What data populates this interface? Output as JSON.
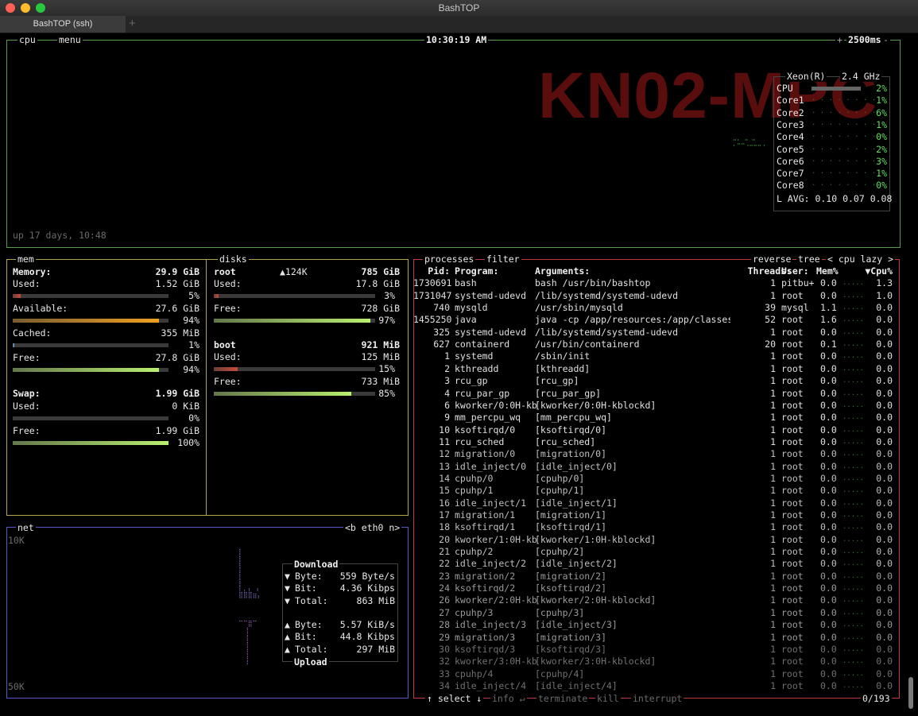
{
  "window": {
    "title": "BashTOP",
    "tab": "BashTOP (ssh)",
    "new_tab": "+"
  },
  "cpu": {
    "label": "cpu",
    "menu_label": "menu",
    "clock": "10:30:19 AM",
    "interval": "2500ms",
    "interval_plus": "+",
    "interval_minus": "-",
    "uptime": "up 17 days, 10:48",
    "hostname": "KN02-MPC",
    "model": "Xeon(R)",
    "freq": "2.4 GHz",
    "cores": [
      {
        "name": "CPU",
        "pct": "2%"
      },
      {
        "name": "Core1",
        "pct": "1%"
      },
      {
        "name": "Core2",
        "pct": "6%"
      },
      {
        "name": "Core3",
        "pct": "1%"
      },
      {
        "name": "Core4",
        "pct": "0%"
      },
      {
        "name": "Core5",
        "pct": "2%"
      },
      {
        "name": "Core6",
        "pct": "3%"
      },
      {
        "name": "Core7",
        "pct": "1%"
      },
      {
        "name": "Core8",
        "pct": "0%"
      }
    ],
    "load_avg": "L AVG: 0.10 0.07 0.08"
  },
  "mem": {
    "label": "mem",
    "memory": {
      "label": "Memory:",
      "value": "29.9 GiB"
    },
    "used": {
      "label": "Used:",
      "value": "1.52 GiB",
      "pct": "5%",
      "level": 0.05,
      "color": "#c84a3a"
    },
    "available": {
      "label": "Available:",
      "value": "27.6 GiB",
      "pct": "94%",
      "level": 0.94,
      "color": "#f0a020"
    },
    "cached": {
      "label": "Cached:",
      "value": "355 MiB",
      "pct": "1%",
      "level": 0.01,
      "color": "#7ab0e0"
    },
    "free": {
      "label": "Free:",
      "value": "27.8 GiB",
      "pct": "94%",
      "level": 0.94,
      "color": "#b8f070"
    },
    "swap": {
      "label": "Swap:",
      "value": "1.99 GiB"
    },
    "swap_used": {
      "label": "Used:",
      "value": "0 KiB",
      "pct": "0%",
      "level": 0.0,
      "color": "#c84a3a"
    },
    "swap_free": {
      "label": "Free:",
      "value": "1.99 GiB",
      "pct": "100%",
      "level": 1.0,
      "color": "#b8f070"
    }
  },
  "disks": {
    "label": "disks",
    "root": {
      "name": "root",
      "io": "▲124K",
      "total": "785 GiB",
      "used": {
        "label": "Used:",
        "value": "17.8 GiB",
        "pct": "3%",
        "level": 0.03,
        "color": "#c84a3a"
      },
      "free": {
        "label": "Free:",
        "value": "728 GiB",
        "pct": "97%",
        "level": 0.97,
        "color": "#b8f070"
      }
    },
    "boot": {
      "name": "boot",
      "total": "921 MiB",
      "used": {
        "label": "Used:",
        "value": "125 MiB",
        "pct": "15%",
        "level": 0.15,
        "color": "#c84a3a"
      },
      "free": {
        "label": "Free:",
        "value": "733 MiB",
        "pct": "85%",
        "level": 0.85,
        "color": "#b8f070"
      }
    }
  },
  "net": {
    "label": "net",
    "iface": "<b eth0 n>",
    "top_scale": "10K",
    "bottom_scale": "50K",
    "download_title": "Download",
    "upload_title": "Upload",
    "down": [
      {
        "arrow": "▼",
        "label": "Byte:",
        "value": "559 Byte/s"
      },
      {
        "arrow": "▼",
        "label": "Bit:",
        "value": "4.36 Kibps"
      },
      {
        "arrow": "▼",
        "label": "Total:",
        "value": "863 MiB"
      }
    ],
    "up": [
      {
        "arrow": "▲",
        "label": "Byte:",
        "value": "5.57 KiB/s"
      },
      {
        "arrow": "▲",
        "label": "Bit:",
        "value": "44.8 Kibps"
      },
      {
        "arrow": "▲",
        "label": "Total:",
        "value": "297 MiB"
      }
    ]
  },
  "proc": {
    "label": "processes",
    "filter": "filter",
    "reverse": "reverse",
    "tree": "tree",
    "sort": "< cpu lazy >",
    "headers": {
      "pid": "Pid:",
      "program": "Program:",
      "args": "Arguments:",
      "threads": "Threads:",
      "user": "User:",
      "mem": "Mem%",
      "cpu": "▼Cpu%"
    },
    "rows": [
      [
        "1730691",
        "bash",
        "bash /usr/bin/bashtop",
        "1",
        "pitbu+",
        "0.0",
        "1.3"
      ],
      [
        "1731047",
        "systemd-udevd",
        "/lib/systemd/systemd-udevd",
        "1",
        "root",
        "0.0",
        "1.0"
      ],
      [
        "740",
        "mysqld",
        "/usr/sbin/mysqld",
        "39",
        "mysql",
        "1.1",
        "0.0"
      ],
      [
        "1455250",
        "java",
        "java -cp /app/resources:/app/classes:/app/li",
        "52",
        "root",
        "1.6",
        "0.0"
      ],
      [
        "325",
        "systemd-udevd",
        "/lib/systemd/systemd-udevd",
        "1",
        "root",
        "0.0",
        "0.0"
      ],
      [
        "627",
        "containerd",
        "/usr/bin/containerd",
        "20",
        "root",
        "0.1",
        "0.0"
      ],
      [
        "1",
        "systemd",
        "/sbin/init",
        "1",
        "root",
        "0.0",
        "0.0"
      ],
      [
        "2",
        "kthreadd",
        "[kthreadd]",
        "1",
        "root",
        "0.0",
        "0.0"
      ],
      [
        "3",
        "rcu_gp",
        "[rcu_gp]",
        "1",
        "root",
        "0.0",
        "0.0"
      ],
      [
        "4",
        "rcu_par_gp",
        "[rcu_par_gp]",
        "1",
        "root",
        "0.0",
        "0.0"
      ],
      [
        "6",
        "kworker/0:0H-kb",
        "[kworker/0:0H-kblockd]",
        "1",
        "root",
        "0.0",
        "0.0"
      ],
      [
        "9",
        "mm_percpu_wq",
        "[mm_percpu_wq]",
        "1",
        "root",
        "0.0",
        "0.0"
      ],
      [
        "10",
        "ksoftirqd/0",
        "[ksoftirqd/0]",
        "1",
        "root",
        "0.0",
        "0.0"
      ],
      [
        "11",
        "rcu_sched",
        "[rcu_sched]",
        "1",
        "root",
        "0.0",
        "0.0"
      ],
      [
        "12",
        "migration/0",
        "[migration/0]",
        "1",
        "root",
        "0.0",
        "0.0"
      ],
      [
        "13",
        "idle_inject/0",
        "[idle_inject/0]",
        "1",
        "root",
        "0.0",
        "0.0"
      ],
      [
        "14",
        "cpuhp/0",
        "[cpuhp/0]",
        "1",
        "root",
        "0.0",
        "0.0"
      ],
      [
        "15",
        "cpuhp/1",
        "[cpuhp/1]",
        "1",
        "root",
        "0.0",
        "0.0"
      ],
      [
        "16",
        "idle_inject/1",
        "[idle_inject/1]",
        "1",
        "root",
        "0.0",
        "0.0"
      ],
      [
        "17",
        "migration/1",
        "[migration/1]",
        "1",
        "root",
        "0.0",
        "0.0"
      ],
      [
        "18",
        "ksoftirqd/1",
        "[ksoftirqd/1]",
        "1",
        "root",
        "0.0",
        "0.0"
      ],
      [
        "20",
        "kworker/1:0H-kb",
        "[kworker/1:0H-kblockd]",
        "1",
        "root",
        "0.0",
        "0.0"
      ],
      [
        "21",
        "cpuhp/2",
        "[cpuhp/2]",
        "1",
        "root",
        "0.0",
        "0.0"
      ],
      [
        "22",
        "idle_inject/2",
        "[idle_inject/2]",
        "1",
        "root",
        "0.0",
        "0.0"
      ],
      [
        "23",
        "migration/2",
        "[migration/2]",
        "1",
        "root",
        "0.0",
        "0.0"
      ],
      [
        "24",
        "ksoftirqd/2",
        "[ksoftirqd/2]",
        "1",
        "root",
        "0.0",
        "0.0"
      ],
      [
        "26",
        "kworker/2:0H-kb",
        "[kworker/2:0H-kblockd]",
        "1",
        "root",
        "0.0",
        "0.0"
      ],
      [
        "27",
        "cpuhp/3",
        "[cpuhp/3]",
        "1",
        "root",
        "0.0",
        "0.0"
      ],
      [
        "28",
        "idle_inject/3",
        "[idle_inject/3]",
        "1",
        "root",
        "0.0",
        "0.0"
      ],
      [
        "29",
        "migration/3",
        "[migration/3]",
        "1",
        "root",
        "0.0",
        "0.0"
      ],
      [
        "30",
        "ksoftirqd/3",
        "[ksoftirqd/3]",
        "1",
        "root",
        "0.0",
        "0.0"
      ],
      [
        "32",
        "kworker/3:0H-kb",
        "[kworker/3:0H-kblockd]",
        "1",
        "root",
        "0.0",
        "0.0"
      ],
      [
        "33",
        "cpuhp/4",
        "[cpuhp/4]",
        "1",
        "root",
        "0.0",
        "0.0"
      ],
      [
        "34",
        "idle_inject/4",
        "[idle_inject/4]",
        "1",
        "root",
        "0.0",
        "0.0"
      ]
    ],
    "footer": {
      "select": "↑ select ↓",
      "info": "info ↵",
      "terminate": "terminate",
      "kill": "kill",
      "interrupt": "interrupt",
      "count": "0/193"
    }
  },
  "colors": {
    "cpu_border": "#5a9a4a",
    "mem_border": "#b0a848",
    "proc_border": "#c03c3c",
    "net_border": "#5858c8"
  }
}
